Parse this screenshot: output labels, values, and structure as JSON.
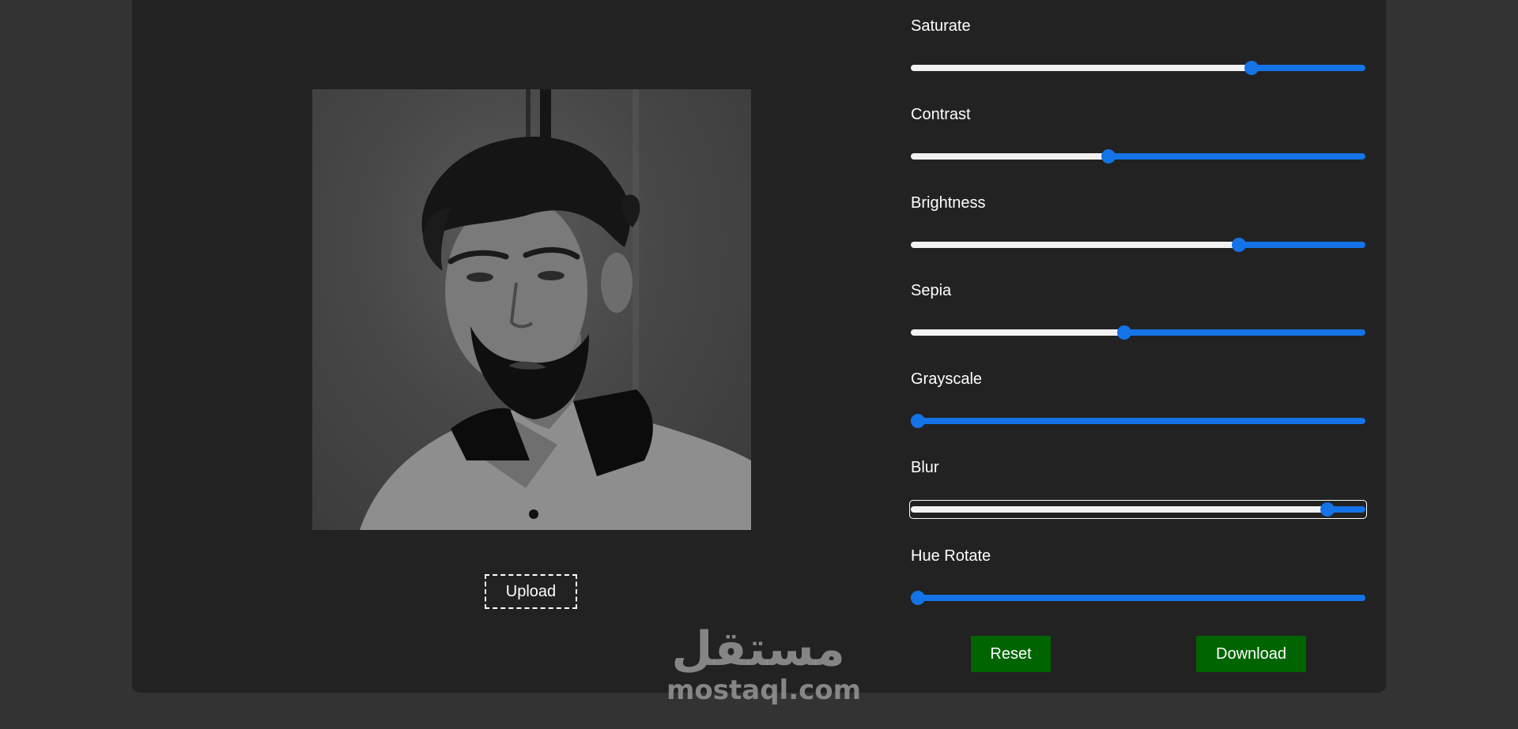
{
  "editor": {
    "upload_label": "Upload",
    "reset_label": "Reset",
    "download_label": "Download"
  },
  "filters": [
    {
      "label": "Saturate",
      "value_fraction": 0.757,
      "focused": false
    },
    {
      "label": "Contrast",
      "value_fraction": 0.432,
      "focused": false
    },
    {
      "label": "Brightness",
      "value_fraction": 0.729,
      "focused": false
    },
    {
      "label": "Sepia",
      "value_fraction": 0.468,
      "focused": false
    },
    {
      "label": "Grayscale",
      "value_fraction": 0.0,
      "focused": false
    },
    {
      "label": "Blur",
      "value_fraction": 0.93,
      "focused": true
    },
    {
      "label": "Hue Rotate",
      "value_fraction": 0.0,
      "focused": false
    }
  ],
  "colors": {
    "background": "#333333",
    "panel": "#222222",
    "slider_accent": "#1473e6",
    "slider_filled": "#f2f2f2",
    "button_green": "#006400"
  },
  "watermark": {
    "logo_text": "مستقل",
    "url_text": "mostaql.com"
  }
}
